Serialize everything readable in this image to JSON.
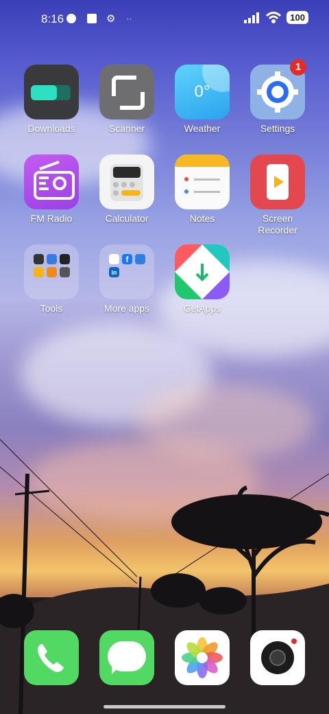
{
  "status_bar": {
    "time": "8:16",
    "battery": "100"
  },
  "apps": {
    "row1": [
      {
        "label": "Downloads"
      },
      {
        "label": "Scanner"
      },
      {
        "label": "Weather",
        "icon_text": "0°"
      },
      {
        "label": "Settings",
        "badge": "1"
      }
    ],
    "row2": [
      {
        "label": "FM Radio"
      },
      {
        "label": "Calculator"
      },
      {
        "label": "Notes"
      },
      {
        "label": "Screen\nRecorder"
      }
    ],
    "row3": [
      {
        "label": "Tools"
      },
      {
        "label": "More apps"
      },
      {
        "label": "GetApps"
      }
    ]
  },
  "dock": [
    "phone-icon",
    "messages-icon",
    "photos-icon",
    "camera-icon"
  ]
}
